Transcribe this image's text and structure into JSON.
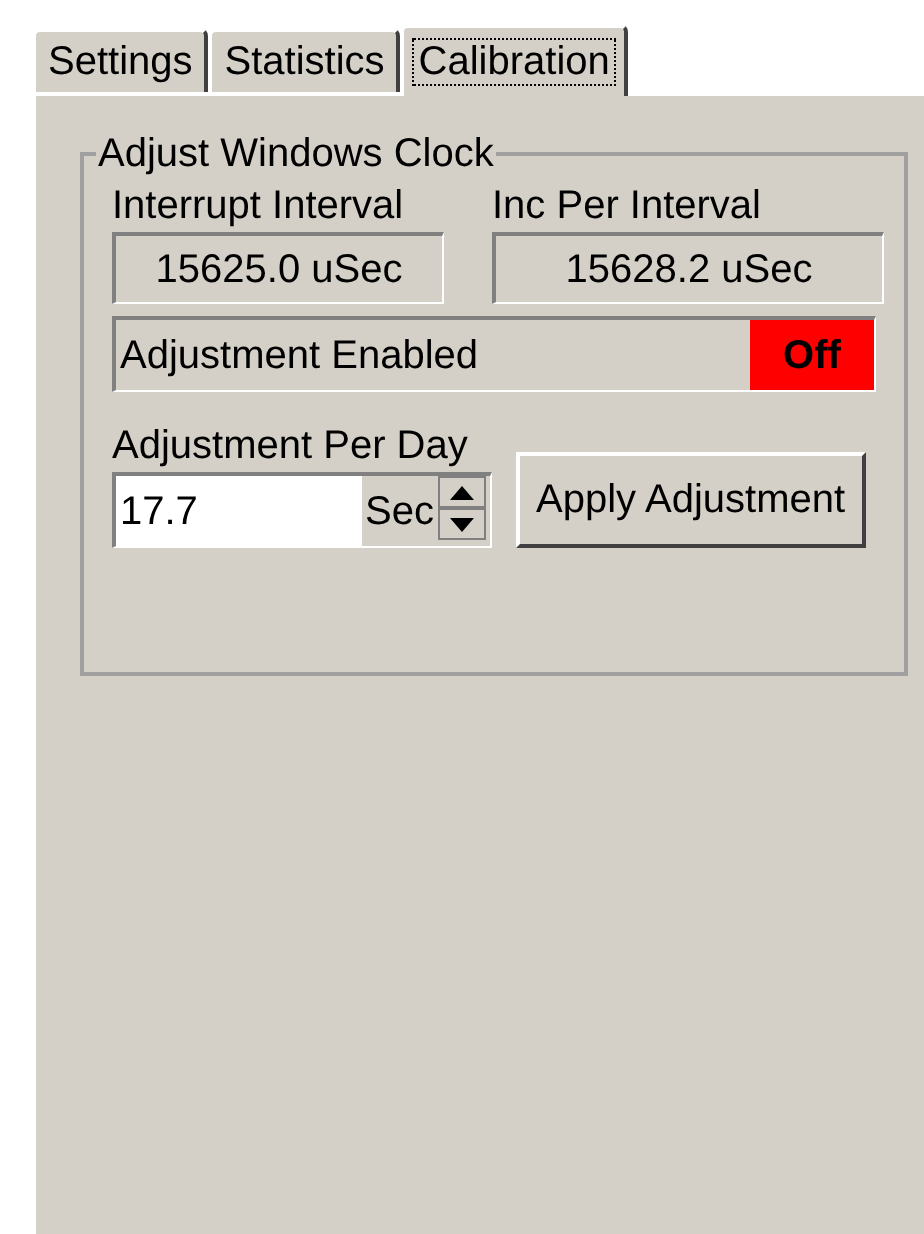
{
  "tabs": [
    {
      "label": "Settings",
      "selected": false
    },
    {
      "label": "Statistics",
      "selected": false
    },
    {
      "label": "Calibration",
      "selected": true
    }
  ],
  "group": {
    "title": "Adjust Windows Clock",
    "readouts": [
      {
        "label": "Interrupt Interval",
        "value": "15625.0 uSec"
      },
      {
        "label": "Inc Per Interval",
        "value": "15628.2 uSec"
      }
    ],
    "adjustment_status": {
      "label": "Adjustment Enabled",
      "value": "Off",
      "enabled": false
    },
    "per_day": {
      "label": "Adjustment Per Day",
      "value": "17.7",
      "unit": "Sec"
    },
    "apply_button": "Apply Adjustment"
  }
}
